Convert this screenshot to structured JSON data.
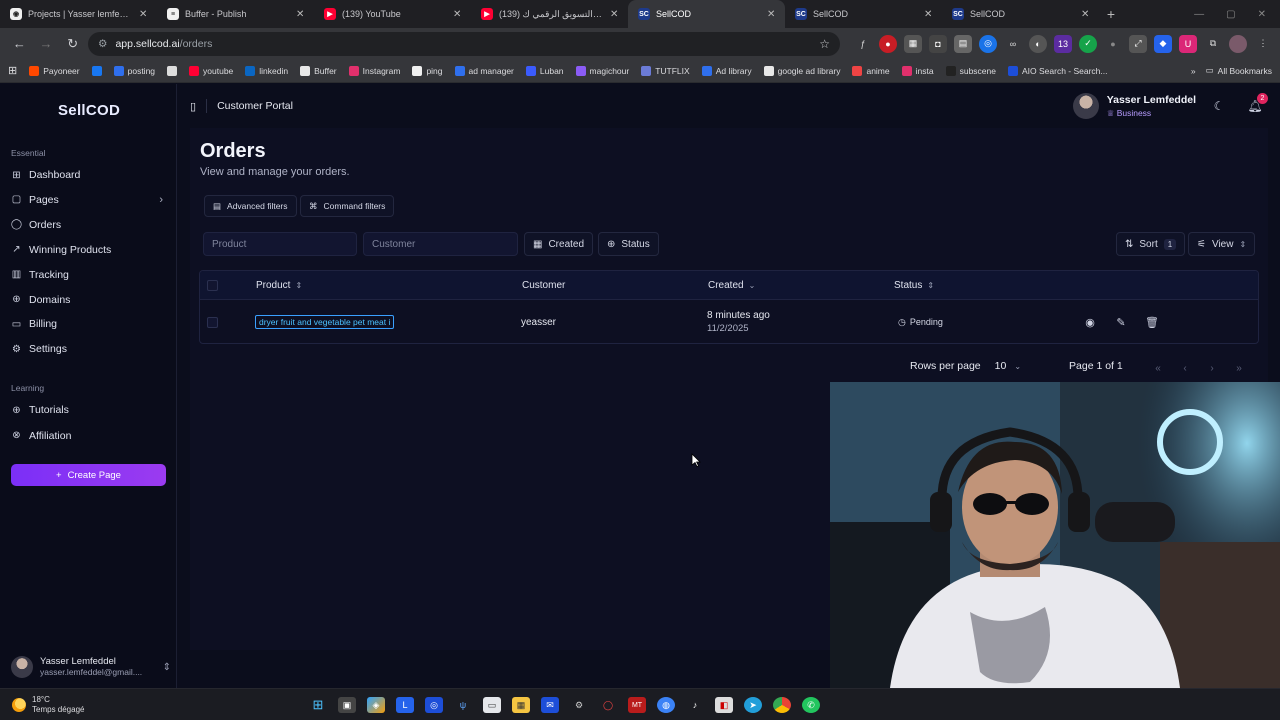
{
  "browser": {
    "tabs": [
      {
        "label": "Projects | Yasser lemfeddel's",
        "favicon": "github-icon",
        "color": "#f0f0f0",
        "glyph": "◉"
      },
      {
        "label": "Buffer - Publish",
        "favicon": "buffer-icon",
        "color": "#f0f0f0",
        "glyph": "≡"
      },
      {
        "label": "(139) YouTube",
        "favicon": "youtube-icon",
        "color": "#ff0033",
        "glyph": "▶"
      },
      {
        "label": "(139) وكالة التسويق الرقمي ك",
        "favicon": "youtube-icon",
        "color": "#ff0033",
        "glyph": "▶"
      },
      {
        "label": "SellCOD",
        "favicon": "sellcod-icon",
        "color": "#1e3a8a",
        "glyph": "SC",
        "active": true
      },
      {
        "label": "SellCOD",
        "favicon": "sellcod-icon",
        "color": "#1e3a8a",
        "glyph": "SC"
      },
      {
        "label": "SellCOD",
        "favicon": "sellcod-icon",
        "color": "#1e3a8a",
        "glyph": "SC"
      }
    ],
    "url_host": "app.sellcod.ai",
    "url_path": "/orders",
    "bookmarks": [
      {
        "label": "Payoneer",
        "color": "#ff4800"
      },
      {
        "label": "",
        "color": "#1877f2"
      },
      {
        "label": "posting",
        "color": "#2f6fed"
      },
      {
        "label": "",
        "color": "#dddddd"
      },
      {
        "label": "youtube",
        "color": "#ff0033"
      },
      {
        "label": "linkedin",
        "color": "#0a66c2"
      },
      {
        "label": "Buffer",
        "color": "#e8e8e8"
      },
      {
        "label": "Instagram",
        "color": "#e1306c"
      },
      {
        "label": "ping",
        "color": "#f0f0f0"
      },
      {
        "label": "ad manager",
        "color": "#2f6fed"
      },
      {
        "label": "Luban",
        "color": "#3b5bfd"
      },
      {
        "label": "magichour",
        "color": "#8b5cf6"
      },
      {
        "label": "TUTFLIX",
        "color": "#6b7bd6"
      },
      {
        "label": "Ad library",
        "color": "#2f6fed"
      },
      {
        "label": "google ad library",
        "color": "#e8e8e8"
      },
      {
        "label": "anime",
        "color": "#ef4444"
      },
      {
        "label": "insta",
        "color": "#e1306c"
      },
      {
        "label": "subscene",
        "color": "#222222"
      },
      {
        "label": "AIO Search - Search...",
        "color": "#1d4ed8"
      }
    ],
    "all_bookmarks": "All Bookmarks"
  },
  "app": {
    "logo": "SellCOD",
    "sidebar": {
      "essential_label": "Essential",
      "items": [
        {
          "label": "Dashboard",
          "icon": "⊞",
          "name": "dashboard"
        },
        {
          "label": "Pages",
          "icon": "▢",
          "name": "pages"
        },
        {
          "label": "Orders",
          "icon": "◯",
          "name": "orders"
        },
        {
          "label": "Winning Products",
          "icon": "↗",
          "name": "winning-products"
        },
        {
          "label": "Tracking",
          "icon": "▥",
          "name": "tracking"
        },
        {
          "label": "Domains",
          "icon": "⊕",
          "name": "domains"
        },
        {
          "label": "Billing",
          "icon": "▭",
          "name": "billing"
        },
        {
          "label": "Settings",
          "icon": "⚙",
          "name": "settings"
        }
      ],
      "learning_label": "Learning",
      "learning_items": [
        {
          "label": "Tutorials",
          "icon": "⊕",
          "name": "tutorials"
        },
        {
          "label": "Affiliation",
          "icon": "⊗",
          "name": "affiliation"
        }
      ],
      "create_page": "Create Page",
      "user_name": "Yasser Lemfeddel",
      "user_email": "yasser.lemfeddel@gmail...."
    },
    "header": {
      "portal": "Customer Portal",
      "user_name": "Yasser Lemfeddel",
      "plan": "Business",
      "notifications": "2"
    },
    "orders": {
      "title": "Orders",
      "subtitle": "View and manage your orders.",
      "advanced_filters": "Advanced filters",
      "command_filters": "Command filters",
      "product_placeholder": "Product",
      "customer_placeholder": "Customer",
      "created_filter": "Created",
      "status_filter": "Status",
      "sort_label": "Sort",
      "sort_count": "1",
      "view_label": "View",
      "columns": {
        "product": "Product",
        "customer": "Customer",
        "created": "Created",
        "status": "Status"
      },
      "rows": [
        {
          "product": "dryer fruit and vegetable pet meat i",
          "customer": "yeasser",
          "created_rel": "8 minutes ago",
          "created_date": "11/2/2025",
          "status": "Pending"
        }
      ],
      "rows_per_page_label": "Rows per page",
      "rows_per_page": "10",
      "page_info": "Page 1 of 1"
    }
  },
  "taskbar": {
    "temp": "18°C",
    "weather": "Temps dégagé"
  }
}
